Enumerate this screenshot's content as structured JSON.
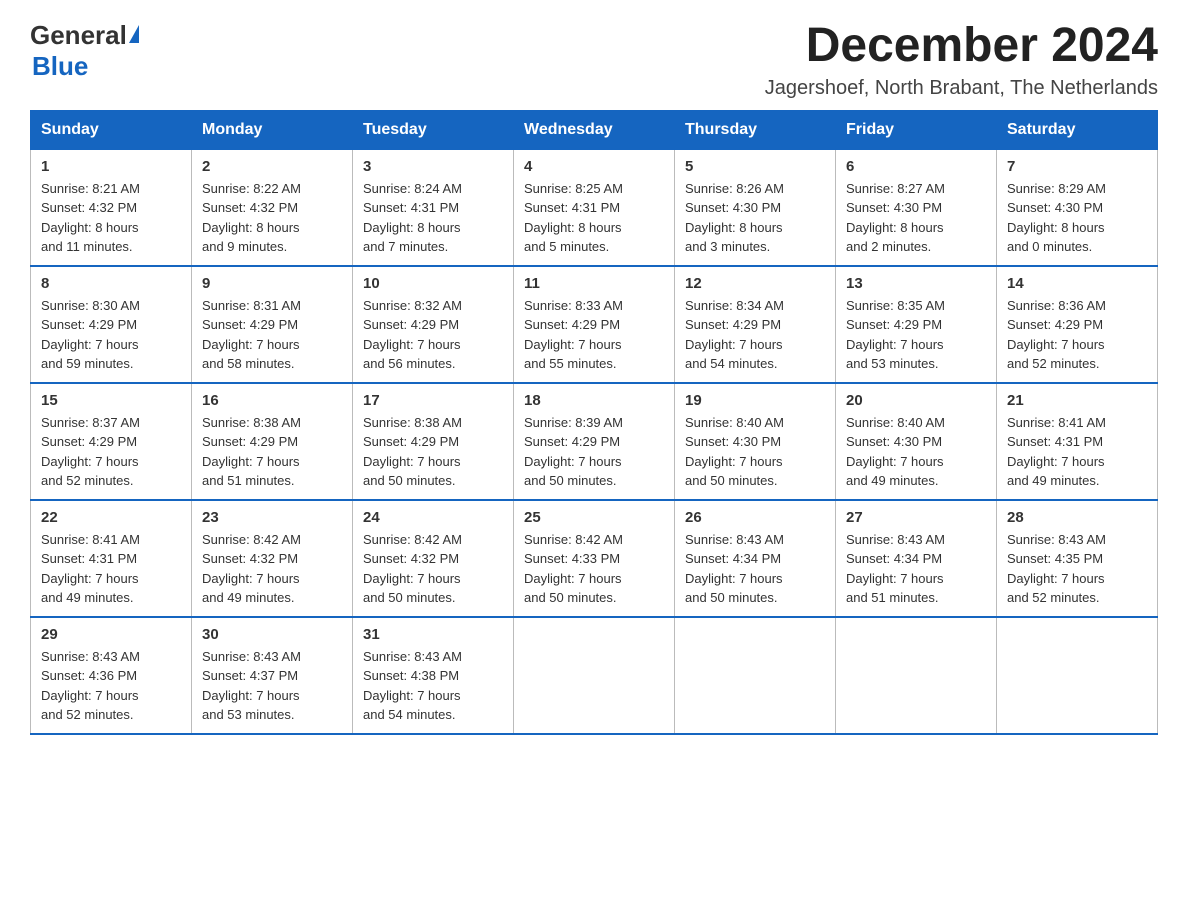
{
  "header": {
    "logo_general": "General",
    "logo_blue": "Blue",
    "title": "December 2024",
    "subtitle": "Jagershoef, North Brabant, The Netherlands"
  },
  "weekdays": [
    "Sunday",
    "Monday",
    "Tuesday",
    "Wednesday",
    "Thursday",
    "Friday",
    "Saturday"
  ],
  "weeks": [
    [
      {
        "day": "1",
        "info": "Sunrise: 8:21 AM\nSunset: 4:32 PM\nDaylight: 8 hours\nand 11 minutes."
      },
      {
        "day": "2",
        "info": "Sunrise: 8:22 AM\nSunset: 4:32 PM\nDaylight: 8 hours\nand 9 minutes."
      },
      {
        "day": "3",
        "info": "Sunrise: 8:24 AM\nSunset: 4:31 PM\nDaylight: 8 hours\nand 7 minutes."
      },
      {
        "day": "4",
        "info": "Sunrise: 8:25 AM\nSunset: 4:31 PM\nDaylight: 8 hours\nand 5 minutes."
      },
      {
        "day": "5",
        "info": "Sunrise: 8:26 AM\nSunset: 4:30 PM\nDaylight: 8 hours\nand 3 minutes."
      },
      {
        "day": "6",
        "info": "Sunrise: 8:27 AM\nSunset: 4:30 PM\nDaylight: 8 hours\nand 2 minutes."
      },
      {
        "day": "7",
        "info": "Sunrise: 8:29 AM\nSunset: 4:30 PM\nDaylight: 8 hours\nand 0 minutes."
      }
    ],
    [
      {
        "day": "8",
        "info": "Sunrise: 8:30 AM\nSunset: 4:29 PM\nDaylight: 7 hours\nand 59 minutes."
      },
      {
        "day": "9",
        "info": "Sunrise: 8:31 AM\nSunset: 4:29 PM\nDaylight: 7 hours\nand 58 minutes."
      },
      {
        "day": "10",
        "info": "Sunrise: 8:32 AM\nSunset: 4:29 PM\nDaylight: 7 hours\nand 56 minutes."
      },
      {
        "day": "11",
        "info": "Sunrise: 8:33 AM\nSunset: 4:29 PM\nDaylight: 7 hours\nand 55 minutes."
      },
      {
        "day": "12",
        "info": "Sunrise: 8:34 AM\nSunset: 4:29 PM\nDaylight: 7 hours\nand 54 minutes."
      },
      {
        "day": "13",
        "info": "Sunrise: 8:35 AM\nSunset: 4:29 PM\nDaylight: 7 hours\nand 53 minutes."
      },
      {
        "day": "14",
        "info": "Sunrise: 8:36 AM\nSunset: 4:29 PM\nDaylight: 7 hours\nand 52 minutes."
      }
    ],
    [
      {
        "day": "15",
        "info": "Sunrise: 8:37 AM\nSunset: 4:29 PM\nDaylight: 7 hours\nand 52 minutes."
      },
      {
        "day": "16",
        "info": "Sunrise: 8:38 AM\nSunset: 4:29 PM\nDaylight: 7 hours\nand 51 minutes."
      },
      {
        "day": "17",
        "info": "Sunrise: 8:38 AM\nSunset: 4:29 PM\nDaylight: 7 hours\nand 50 minutes."
      },
      {
        "day": "18",
        "info": "Sunrise: 8:39 AM\nSunset: 4:29 PM\nDaylight: 7 hours\nand 50 minutes."
      },
      {
        "day": "19",
        "info": "Sunrise: 8:40 AM\nSunset: 4:30 PM\nDaylight: 7 hours\nand 50 minutes."
      },
      {
        "day": "20",
        "info": "Sunrise: 8:40 AM\nSunset: 4:30 PM\nDaylight: 7 hours\nand 49 minutes."
      },
      {
        "day": "21",
        "info": "Sunrise: 8:41 AM\nSunset: 4:31 PM\nDaylight: 7 hours\nand 49 minutes."
      }
    ],
    [
      {
        "day": "22",
        "info": "Sunrise: 8:41 AM\nSunset: 4:31 PM\nDaylight: 7 hours\nand 49 minutes."
      },
      {
        "day": "23",
        "info": "Sunrise: 8:42 AM\nSunset: 4:32 PM\nDaylight: 7 hours\nand 49 minutes."
      },
      {
        "day": "24",
        "info": "Sunrise: 8:42 AM\nSunset: 4:32 PM\nDaylight: 7 hours\nand 50 minutes."
      },
      {
        "day": "25",
        "info": "Sunrise: 8:42 AM\nSunset: 4:33 PM\nDaylight: 7 hours\nand 50 minutes."
      },
      {
        "day": "26",
        "info": "Sunrise: 8:43 AM\nSunset: 4:34 PM\nDaylight: 7 hours\nand 50 minutes."
      },
      {
        "day": "27",
        "info": "Sunrise: 8:43 AM\nSunset: 4:34 PM\nDaylight: 7 hours\nand 51 minutes."
      },
      {
        "day": "28",
        "info": "Sunrise: 8:43 AM\nSunset: 4:35 PM\nDaylight: 7 hours\nand 52 minutes."
      }
    ],
    [
      {
        "day": "29",
        "info": "Sunrise: 8:43 AM\nSunset: 4:36 PM\nDaylight: 7 hours\nand 52 minutes."
      },
      {
        "day": "30",
        "info": "Sunrise: 8:43 AM\nSunset: 4:37 PM\nDaylight: 7 hours\nand 53 minutes."
      },
      {
        "day": "31",
        "info": "Sunrise: 8:43 AM\nSunset: 4:38 PM\nDaylight: 7 hours\nand 54 minutes."
      },
      {
        "day": "",
        "info": ""
      },
      {
        "day": "",
        "info": ""
      },
      {
        "day": "",
        "info": ""
      },
      {
        "day": "",
        "info": ""
      }
    ]
  ]
}
